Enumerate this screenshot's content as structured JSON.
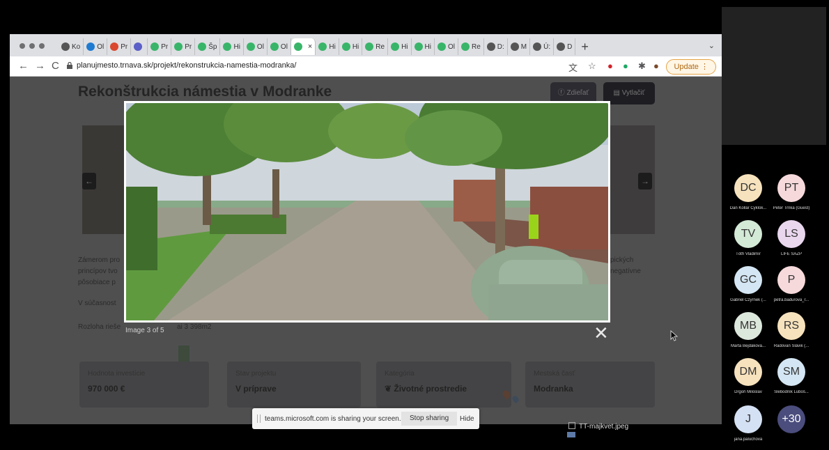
{
  "browser": {
    "tabs": [
      {
        "label": "Ko",
        "icon": "globe-icon"
      },
      {
        "label": "Ol",
        "icon": "cloud-icon"
      },
      {
        "label": "Pr",
        "icon": "red-app-icon"
      },
      {
        "label": "",
        "icon": "teams-icon"
      },
      {
        "label": "Pr",
        "icon": "planuj-icon"
      },
      {
        "label": "Pr",
        "icon": "planuj-icon"
      },
      {
        "label": "Šp",
        "icon": "planuj-icon"
      },
      {
        "label": "Hi",
        "icon": "planuj-icon"
      },
      {
        "label": "Ol",
        "icon": "planuj-icon"
      },
      {
        "label": "Ol",
        "icon": "planuj-icon"
      },
      {
        "label": "",
        "icon": "planuj-icon",
        "active": true
      },
      {
        "label": "Hi",
        "icon": "planuj-icon"
      },
      {
        "label": "Hi",
        "icon": "planuj-icon"
      },
      {
        "label": "Re",
        "icon": "planuj-icon"
      },
      {
        "label": "Hi",
        "icon": "planuj-icon"
      },
      {
        "label": "Hi",
        "icon": "planuj-icon"
      },
      {
        "label": "Ol",
        "icon": "planuj-icon"
      },
      {
        "label": "Re",
        "icon": "planuj-icon"
      },
      {
        "label": "D:",
        "icon": "globe-icon"
      },
      {
        "label": "M",
        "icon": "globe-icon"
      },
      {
        "label": "Ú:",
        "icon": "globe-icon"
      },
      {
        "label": "D",
        "icon": "globe-icon"
      }
    ],
    "new_tab": "+",
    "tab_menu": "⌄",
    "url": "planujmesto.trnava.sk/projekt/rekonstrukcia-namestia-modranka/",
    "update_label": "Update",
    "update_menu": "⋮"
  },
  "page": {
    "title": "Rekonštrukcia námestia v Modranke",
    "share_label": "Zdieľať",
    "print_label": "Vytlačiť",
    "paragraph1": [
      "Zámerom pro",
      "princípov tvo",
      "pôsobiace p"
    ],
    "paragraph1_right": [
      "pických",
      "negatívne"
    ],
    "paragraph2": "V súčasnost",
    "paragraph3": "Rozloha rieše",
    "paragraph3_tail": "ai 3 398m2",
    "cards": [
      {
        "label": "Hodnota investície",
        "value": "970 000 €"
      },
      {
        "label": "Stav projektu",
        "value": "V príprave"
      },
      {
        "label": "Kategória",
        "value": "Životné prostredie"
      },
      {
        "label": "Mestská časť",
        "value": "Modranka"
      }
    ]
  },
  "lightbox": {
    "counter": "Image 3 of 5",
    "close": "✕"
  },
  "share_bar": {
    "text": "teams.microsoft.com is sharing your screen.",
    "stop_label": "Stop sharing",
    "hide_label": "Hide"
  },
  "taskbar": {
    "file": "TT-majkvet.jpeg"
  },
  "participants": [
    {
      "initials": "DC",
      "name": "Dan Kollár Cyklok...",
      "color": "#f6e2bd"
    },
    {
      "initials": "PT",
      "name": "Peter Trnka (Guest)",
      "color": "#f6d9db"
    },
    {
      "initials": "TV",
      "name": "Tóth Vladimír",
      "color": "#d3ead6"
    },
    {
      "initials": "LS",
      "name": "LIFE SAŽP",
      "color": "#e9d7ee"
    },
    {
      "initials": "GC",
      "name": "Gabriel Czyrnek (...",
      "color": "#d4e6f3"
    },
    {
      "initials": "P",
      "name": "petra.badurova_r...",
      "color": "#f6d9db"
    },
    {
      "initials": "MB",
      "name": "Marta Bejdáková...",
      "color": "#dde8dd"
    },
    {
      "initials": "RS",
      "name": "Radovan Slávik (...",
      "color": "#f6e2bd"
    },
    {
      "initials": "DM",
      "name": "Drgoň Miloslav",
      "color": "#f6e2bd"
    },
    {
      "initials": "SM",
      "name": "Slebodník Luboš...",
      "color": "#d4e6f3"
    },
    {
      "initials": "J",
      "name": "jana.paluchova",
      "color": "#d4e1f4"
    },
    {
      "initials": "+30",
      "name": "",
      "color": "#4b4d7d"
    }
  ]
}
